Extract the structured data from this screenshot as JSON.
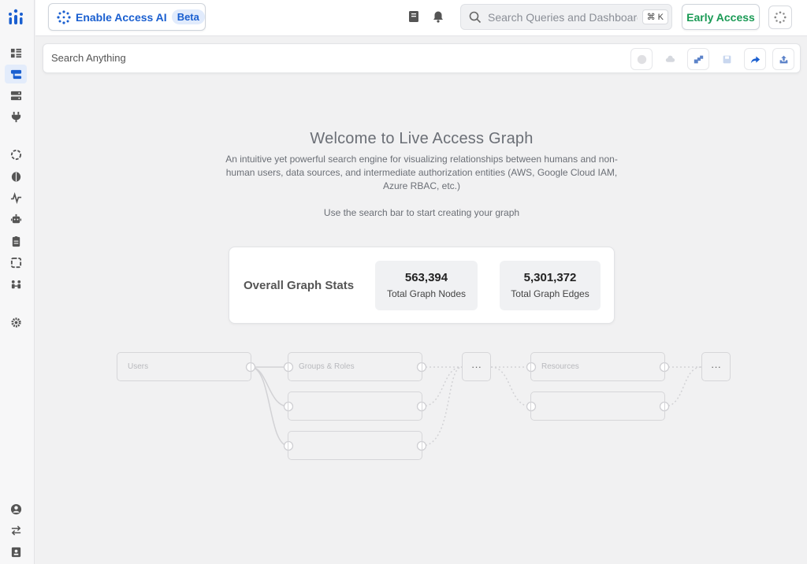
{
  "topbar": {
    "ai_button_label": "Enable Access AI",
    "ai_badge": "Beta",
    "search_placeholder": "Search Queries and Dashboard",
    "search_shortcut": "⌘ K",
    "early_access_label": "Early Access"
  },
  "searchbar": {
    "placeholder": "Search Anything"
  },
  "welcome": {
    "title": "Welcome to Live Access Graph",
    "subtitle": "An intuitive yet powerful search engine for visualizing relationships between humans and non-human users, data sources, and intermediate authorization entities (AWS, Google Cloud IAM, Azure RBAC, etc.)",
    "hint": "Use the search bar to start creating your graph"
  },
  "stats": {
    "title": "Overall Graph Stats",
    "nodes_value": "563,394",
    "nodes_label": "Total Graph Nodes",
    "edges_value": "5,301,372",
    "edges_label": "Total Graph Edges"
  },
  "graph": {
    "users_label": "Users",
    "groups_label": "Groups & Roles",
    "resources_label": "Resources",
    "more_label": "···"
  },
  "colors": {
    "accent": "#1a5fd0",
    "early_access": "#1a9a55"
  }
}
